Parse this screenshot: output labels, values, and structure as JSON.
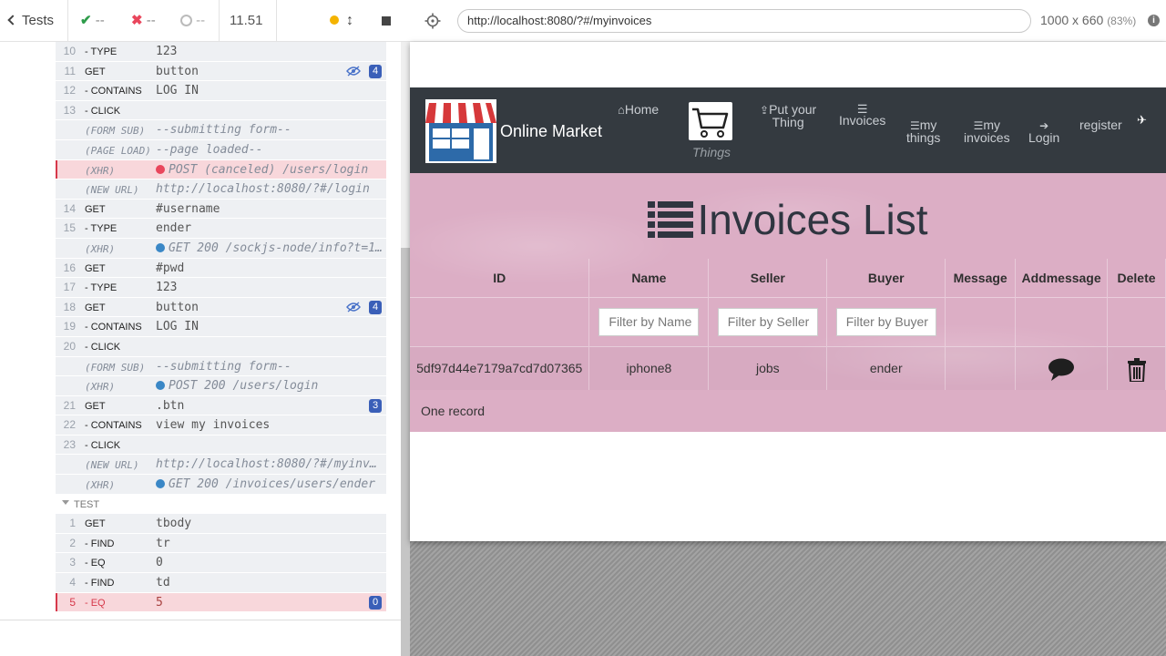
{
  "reporter": {
    "back_label": "Tests",
    "passed": "--",
    "failed": "--",
    "pending": "--",
    "duration": "11.51"
  },
  "commands": [
    {
      "num": "10",
      "name": "- TYPE",
      "msg": "123",
      "type": "child"
    },
    {
      "num": "11",
      "name": "GET",
      "msg": "button",
      "badge": "4",
      "eye": true
    },
    {
      "num": "12",
      "name": "- CONTAINS",
      "msg": "LOG IN"
    },
    {
      "num": "13",
      "name": "- CLICK",
      "msg": ""
    },
    {
      "num": "",
      "name": "(FORM SUB)",
      "msg": "--submitting form--",
      "sub": true
    },
    {
      "num": "",
      "name": "(PAGE LOAD)",
      "msg": "--page loaded--",
      "sub": true
    },
    {
      "num": "",
      "name": "(XHR)",
      "msg": "POST (canceled) /users/login",
      "sub": true,
      "dot": "red",
      "err": true
    },
    {
      "num": "",
      "name": "(NEW URL)",
      "msg": "http://localhost:8080/?#/login",
      "sub": true
    },
    {
      "num": "14",
      "name": "GET",
      "msg": "#username"
    },
    {
      "num": "15",
      "name": "- TYPE",
      "msg": "ender"
    },
    {
      "num": "",
      "name": "(XHR)",
      "msg": "GET 200 /sockjs-node/info?t=157…",
      "sub": true,
      "dot": "blue"
    },
    {
      "num": "16",
      "name": "GET",
      "msg": "#pwd"
    },
    {
      "num": "17",
      "name": "- TYPE",
      "msg": "123"
    },
    {
      "num": "18",
      "name": "GET",
      "msg": "button",
      "badge": "4",
      "eye": true
    },
    {
      "num": "19",
      "name": "- CONTAINS",
      "msg": "LOG IN"
    },
    {
      "num": "20",
      "name": "- CLICK",
      "msg": ""
    },
    {
      "num": "",
      "name": "(FORM SUB)",
      "msg": "--submitting form--",
      "sub": true
    },
    {
      "num": "",
      "name": "(XHR)",
      "msg": "POST 200 /users/login",
      "sub": true,
      "dot": "blue"
    },
    {
      "num": "21",
      "name": "GET",
      "msg": ".btn",
      "badge": "3"
    },
    {
      "num": "22",
      "name": "- CONTAINS",
      "msg": "view my invoices"
    },
    {
      "num": "23",
      "name": "- CLICK",
      "msg": ""
    },
    {
      "num": "",
      "name": "(NEW URL)",
      "msg": "http://localhost:8080/?#/myinvoic…",
      "sub": true
    },
    {
      "num": "",
      "name": "(XHR)",
      "msg": "GET 200 /invoices/users/ender",
      "sub": true,
      "dot": "blue"
    }
  ],
  "test_label": "TEST",
  "test_commands": [
    {
      "num": "1",
      "name": "GET",
      "msg": "tbody"
    },
    {
      "num": "2",
      "name": "- FIND",
      "msg": "tr"
    },
    {
      "num": "3",
      "name": "- EQ",
      "msg": "0"
    },
    {
      "num": "4",
      "name": "- FIND",
      "msg": "td"
    },
    {
      "num": "5",
      "name": "- EQ",
      "msg": "5",
      "badge": "0",
      "failed": true
    }
  ],
  "aut": {
    "url": "http://localhost:8080/?#/myinvoices",
    "viewport": "1000 x 660",
    "scale": "(83%)"
  },
  "site": {
    "brand": "Online Market",
    "nav": {
      "home": "Home",
      "things": "Things",
      "put_line1": "Put your",
      "put_line2": "Thing",
      "invoices": "Invoices",
      "my_things_1": "my",
      "my_things_2": "things",
      "my_invoices_1": "my",
      "my_invoices_2": "invoices",
      "login": "Login",
      "register": "register"
    },
    "heading": "Invoices List",
    "table": {
      "headers": [
        "ID",
        "Name",
        "Seller",
        "Buyer",
        "Message",
        "Addmessage",
        "Delete"
      ],
      "filters": {
        "name": "Filter by Name",
        "seller": "Filter by Seller",
        "buyer": "Filter by Buyer"
      },
      "rows": [
        {
          "id": "5df97d44e7179a7cd7d07365",
          "name": "iphone8",
          "seller": "jobs",
          "buyer": "ender",
          "message": ""
        }
      ]
    },
    "footer_count": "One record"
  },
  "colors": {
    "nav_bg": "#343a40",
    "content_bg": "#dcaec5",
    "badge": "#3a5fb8",
    "fail": "#d6384a",
    "pass": "#2e9c4a"
  }
}
